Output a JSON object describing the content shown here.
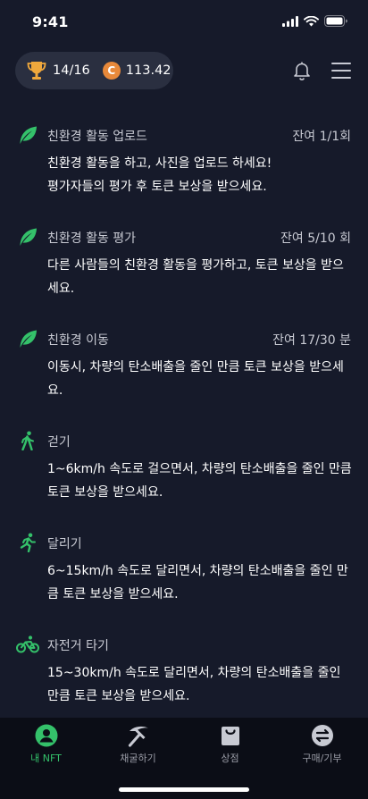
{
  "status": {
    "time": "9:41"
  },
  "header": {
    "trophy": "14/16",
    "coin_symbol": "C",
    "coin_value": "113.42"
  },
  "activities": [
    {
      "icon": "leaf-icon",
      "title": "친환경 활동 업로드",
      "remain": "잔여 1/1회",
      "lines": [
        "친환경 활동을 하고, 사진을 업로드 하세요!",
        "평가자들의 평가 후 토큰 보상을 받으세요."
      ]
    },
    {
      "icon": "leaf-icon",
      "title": "친환경 활동 평가",
      "remain": "잔여 5/10 회",
      "lines": [
        "다른 사람들의 친환경 활동을 평가하고, 토큰 보상을 받으",
        "세요."
      ]
    },
    {
      "icon": "leaf-icon",
      "title": "친환경 이동",
      "remain": "잔여 17/30 분",
      "lines": [
        "이동시, 차량의 탄소배출을 줄인 만큼 토큰 보상을 받으세",
        "요."
      ]
    },
    {
      "icon": "walking-icon",
      "title": "걷기",
      "remain": "",
      "lines": [
        "1~6km/h 속도로 걸으면서, 차량의 탄소배출을 줄인 만큼",
        "토큰 보상을 받으세요."
      ]
    },
    {
      "icon": "running-icon",
      "title": "달리기",
      "remain": "",
      "lines": [
        "6~15km/h 속도로 달리면서, 차량의 탄소배출을 줄인 만",
        "큼 토큰 보상을 받으세요."
      ]
    },
    {
      "icon": "bicycle-icon",
      "title": "자전거 타기",
      "remain": "",
      "lines": [
        "15~30km/h 속도로 달리면서, 차량의 탄소배출을 줄인",
        "만큼 토큰 보상을 받으세요."
      ]
    }
  ],
  "tabs": [
    {
      "label": "내 NFT",
      "icon": "user-icon",
      "active": true
    },
    {
      "label": "채굴하기",
      "icon": "pickaxe-icon",
      "active": false
    },
    {
      "label": "상점",
      "icon": "shopping-bag-icon",
      "active": false
    },
    {
      "label": "구매/기부",
      "icon": "exchange-icon",
      "active": false
    }
  ],
  "colors": {
    "background": "#161a2a",
    "accent": "#34c16a",
    "coin": "#e8893a",
    "tabbar": "#0b0d16"
  }
}
